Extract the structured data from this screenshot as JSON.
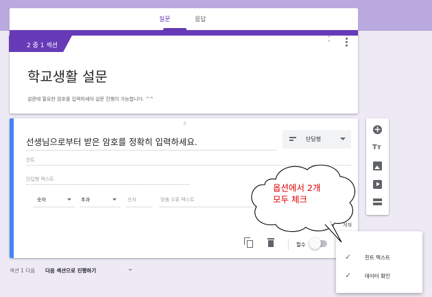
{
  "tabs": [
    {
      "label": "질문",
      "active": true
    },
    {
      "label": "응답",
      "active": false
    }
  ],
  "section": {
    "badge": "2 중 1 섹션",
    "title": "학교생활 설문",
    "description": "설문에 필요한 암호를 입력하세야 설문 진행이 가능합니다. ^^"
  },
  "question": {
    "drag_handle": "⠿",
    "title": "선생님으로부터 받은 암호를 정확히 입력하세요.",
    "type_label": "단답형",
    "hint_placeholder": "힌트",
    "short_answer_placeholder": "단답형 텍스트",
    "validation": {
      "category": "숫자",
      "operator": "초과",
      "number_placeholder": "숫자",
      "error_placeholder": "맞춤 오류 텍스트"
    },
    "required_label": "필수"
  },
  "toolbar_icons": [
    "add-question-icon",
    "add-title-icon",
    "add-image-icon",
    "add-video-icon",
    "add-section-icon"
  ],
  "options_menu": {
    "clipped_label": "게재",
    "items": [
      {
        "label": "힌트 텍스트",
        "checked": true
      },
      {
        "label": "데이터 확인",
        "checked": true
      }
    ]
  },
  "after_section": {
    "label": "섹션 1 다음",
    "value": "다음 섹션으로 진행하기"
  },
  "callout": {
    "line1": "옵션에서 2개",
    "line2": "모두 체크"
  },
  "colors": {
    "accent": "#673ab7",
    "active_border": "#4285f4",
    "callout_text": "#e00000"
  }
}
